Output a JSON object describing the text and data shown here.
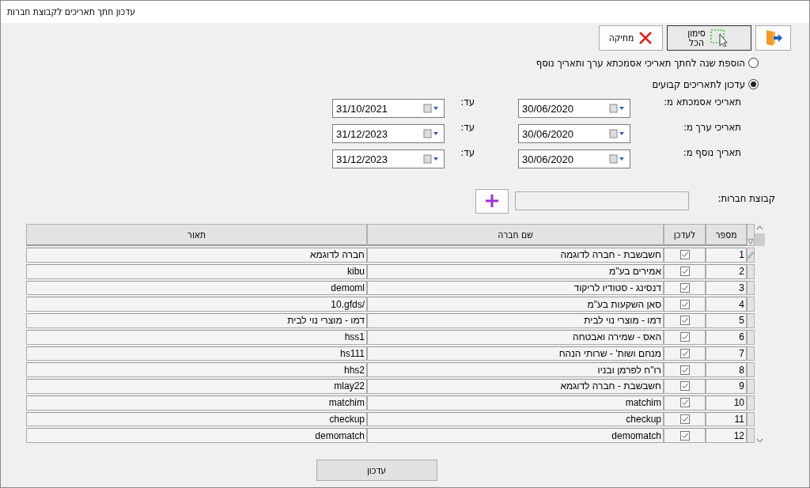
{
  "window": {
    "title": "עדכון חתך תאריכים לקבוצת חברות"
  },
  "toolbar": [
    {
      "kind": "exit"
    },
    {
      "kind": "select_all",
      "label": "סימון\nהכל"
    },
    {
      "kind": "delete",
      "label": "מחיקה"
    }
  ],
  "options": [
    {
      "label": "הוספת שנה לחתך תאריכי אסמכתא ערך ותאריך נוסף",
      "selected": false
    },
    {
      "label": "עדכון לתאריכים קבועים",
      "selected": true
    }
  ],
  "date_ranges": [
    {
      "label": "תאריכי אסמכתא מ:",
      "from": "30/06/2020",
      "to_label": "עד:",
      "to": "31/10/2021"
    },
    {
      "label": "תאריכי ערך מ:",
      "from": "30/06/2020",
      "to_label": "עד:",
      "to": "31/12/2023"
    },
    {
      "label": "תאריך נוסף מ:",
      "from": "30/06/2020",
      "to_label": "עד:",
      "to": "31/12/2023"
    }
  ],
  "company_group": {
    "label": "קבוצת חברות:"
  },
  "table": {
    "columns": [
      "מספר",
      "לעדכן",
      "שם חברה",
      "תאור"
    ],
    "rows": [
      {
        "number": "1",
        "update": true,
        "name": "חשבשבת - חברה לדוגמה",
        "description": "חברה לדוגמא",
        "editing": true
      },
      {
        "number": "2",
        "update": true,
        "name": "אמירים בע\"מ",
        "description": "kibu",
        "editing": false
      },
      {
        "number": "3",
        "update": true,
        "name": "דנסינג - סטודיו לריקוד",
        "description": "demoml",
        "editing": false
      },
      {
        "number": "4",
        "update": true,
        "name": "סאן השקעות בע\"מ",
        "description": "10.gfds/",
        "editing": false
      },
      {
        "number": "5",
        "update": true,
        "name": "דמו - מוצרי נוי לבית",
        "description": "דמו - מוצרי נוי לבית",
        "editing": false
      },
      {
        "number": "6",
        "update": true,
        "name": "האס - שמירה ואבטחה",
        "description": "hss1",
        "editing": false
      },
      {
        "number": "7",
        "update": true,
        "name": "מנחם ושות' - שרותי הנהח",
        "description": "hs111",
        "editing": false
      },
      {
        "number": "8",
        "update": true,
        "name": "רו\"ח לפרמן ובניו",
        "description": "hhs2",
        "editing": false
      },
      {
        "number": "9",
        "update": true,
        "name": "חשבשבת - חברה לדוגמא",
        "description": "mlay22",
        "editing": false
      },
      {
        "number": "10",
        "update": true,
        "name": "matchim",
        "description": "matchim",
        "editing": false
      },
      {
        "number": "11",
        "update": true,
        "name": "checkup",
        "description": "checkup",
        "editing": false
      },
      {
        "number": "12",
        "update": true,
        "name": "demomatch",
        "description": "demomatch",
        "editing": false
      }
    ]
  },
  "update_button": "עדכון"
}
